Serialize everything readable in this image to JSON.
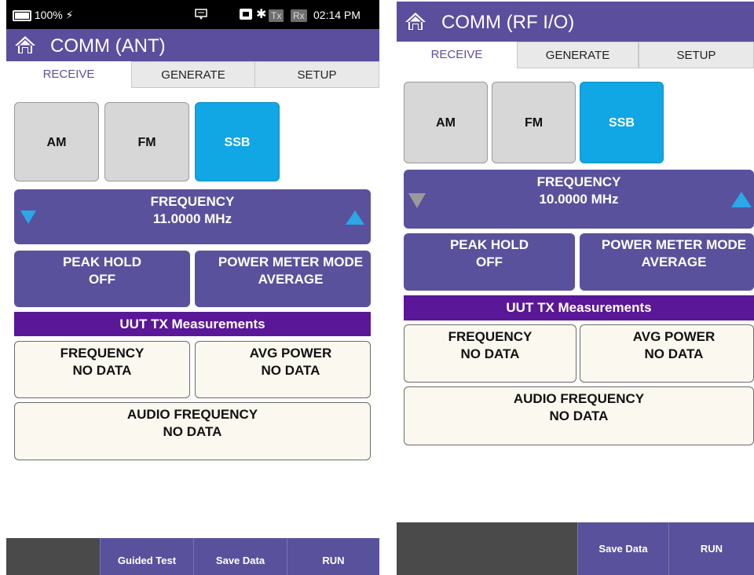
{
  "left": {
    "status": {
      "battery": "100%",
      "time": "02:14 PM",
      "tx": "Tx",
      "rx": "Rx"
    },
    "title": "COMM (ANT)",
    "tabs": [
      "RECEIVE",
      "GENERATE",
      "SETUP"
    ],
    "modes": [
      "AM",
      "FM",
      "SSB"
    ],
    "frequency": {
      "label": "FREQUENCY",
      "value": "11.0000 MHz"
    },
    "peak_hold": {
      "label": "PEAK HOLD",
      "value": "OFF"
    },
    "power_meter": {
      "label": "POWER METER MODE",
      "value": "AVERAGE"
    },
    "uut_header": "UUT TX Measurements",
    "meas_frequency": {
      "label": "FREQUENCY",
      "value": "NO DATA"
    },
    "meas_avg_power": {
      "label": "AVG POWER",
      "value": "NO DATA"
    },
    "meas_audio": {
      "label": "AUDIO FREQUENCY",
      "value": "NO DATA"
    },
    "bottom": [
      "Guided Test",
      "Save Data",
      "RUN"
    ]
  },
  "right": {
    "title": "COMM (RF I/O)",
    "tabs": [
      "RECEIVE",
      "GENERATE",
      "SETUP"
    ],
    "modes": [
      "AM",
      "FM",
      "SSB"
    ],
    "frequency": {
      "label": "FREQUENCY",
      "value": "10.0000 MHz"
    },
    "peak_hold": {
      "label": "PEAK HOLD",
      "value": "OFF"
    },
    "power_meter": {
      "label": "POWER METER MODE",
      "value": "AVERAGE"
    },
    "uut_header": "UUT TX Measurements",
    "meas_frequency": {
      "label": "FREQUENCY",
      "value": "NO DATA"
    },
    "meas_avg_power": {
      "label": "AVG POWER",
      "value": "NO DATA"
    },
    "meas_audio": {
      "label": "AUDIO FREQUENCY",
      "value": "NO DATA"
    },
    "bottom": [
      "Save Data",
      "RUN"
    ]
  },
  "colors": {
    "accent": "#5a519c",
    "active_mode": "#11a6e4",
    "uut_header": "#5a1797"
  },
  "icons": [
    "home-icon",
    "battery-icon",
    "charging-icon",
    "keyboard-icon",
    "ethernet-icon",
    "bluetooth-icon",
    "triangle-down-icon",
    "triangle-up-icon"
  ]
}
